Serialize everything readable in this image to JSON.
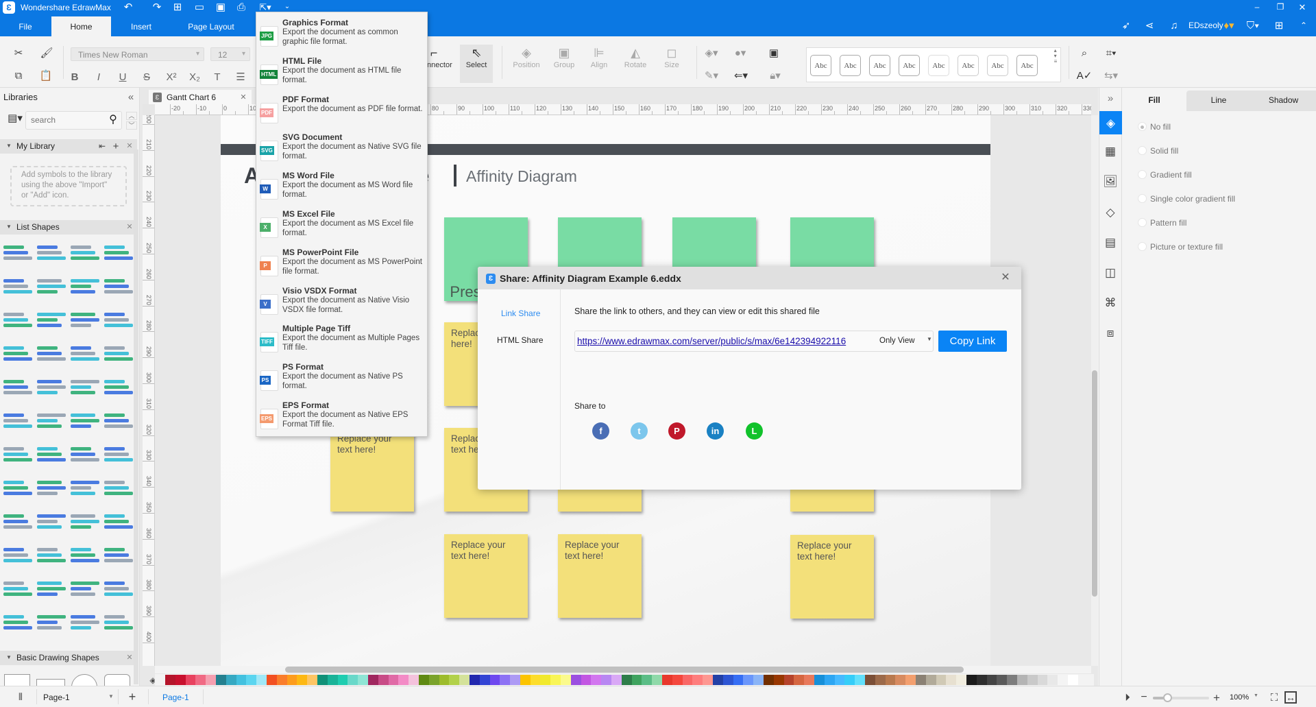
{
  "app": {
    "title": "Wondershare EdrawMax",
    "user": "EDszeoly",
    "tabs": [
      "File",
      "Home",
      "Insert",
      "Page Layout"
    ],
    "active_tab": "Home"
  },
  "toolbar": {
    "font": "Times New Roman",
    "size": "12",
    "buttons": [
      "Connector",
      "Select",
      "Position",
      "Group",
      "Align",
      "Rotate",
      "Size"
    ],
    "style_label": "Abc",
    "format_buttons": [
      "B",
      "I",
      "U",
      "S",
      "X²",
      "X₂",
      "T"
    ]
  },
  "export_menu": [
    {
      "title": "Graphics Format",
      "desc": "Export the document as common graphic file format.",
      "icon_label": "JPG",
      "color": "#1e9e45"
    },
    {
      "title": "HTML File",
      "desc": "Export the document as HTML file format.",
      "icon_label": "HTML",
      "color": "#13833a"
    },
    {
      "title": "PDF Format",
      "desc": "Export the document as PDF file format.",
      "icon_label": "PDF",
      "color": "#f6a0a0"
    },
    {
      "title": "SVG Document",
      "desc": "Export the document as Native SVG file format.",
      "icon_label": "SVG",
      "color": "#1aa3a8"
    },
    {
      "title": "MS Word File",
      "desc": "Export the document as MS Word file format.",
      "icon_label": "W",
      "color": "#1f5cb8"
    },
    {
      "title": "MS Excel File",
      "desc": "Export the document as MS Excel file format.",
      "icon_label": "X",
      "color": "#4caf6a"
    },
    {
      "title": "MS PowerPoint File",
      "desc": "Export the document as MS PowerPoint file format.",
      "icon_label": "P",
      "color": "#ef8250"
    },
    {
      "title": "Visio VSDX Format",
      "desc": "Export the document as Native Visio VSDX file format.",
      "icon_label": "V",
      "color": "#3b6fc9"
    },
    {
      "title": "Multiple Page Tiff",
      "desc": "Export the document as Multiple Pages Tiff file.",
      "icon_label": "TIFF",
      "color": "#2cbcc8"
    },
    {
      "title": "PS Format",
      "desc": "Export the document as Native PS format.",
      "icon_label": "PS",
      "color": "#1a66c4"
    },
    {
      "title": "EPS Format",
      "desc": "Export the document as Native EPS Format Tiff file.",
      "icon_label": "EPS",
      "color": "#f49a6e"
    }
  ],
  "libraries": {
    "title": "Libraries",
    "search_placeholder": "search",
    "my_library": "My Library",
    "my_library_hint": "Add symbols to the library using the above \"Import\" or \"Add\" icon.",
    "list_shapes": "List Shapes",
    "basic_shapes": "Basic Drawing Shapes"
  },
  "document": {
    "tab": "Gantt Chart 6",
    "title_left": "A",
    "title_mid": "re",
    "subtitle": "Affinity Diagram",
    "preset_text": "Preset text",
    "note_text": "Replace your text here!",
    "note_partial": "Replac here!",
    "ruler_h": {
      "start": -20,
      "end": 330,
      "step": 10
    },
    "ruler_v": {
      "start": 200,
      "end": 400,
      "step": 10
    }
  },
  "share_dialog": {
    "title": "Share: Affinity Diagram Example 6.eddx",
    "nav": [
      "Link Share",
      "HTML Share"
    ],
    "active_nav": "Link Share",
    "description": "Share the link to others, and they can view or edit this shared file",
    "url": "https://www.edrawmax.com/server/public/s/max/6e142394922116",
    "permission": "Only View",
    "copy_button": "Copy Link",
    "share_to": "Share to",
    "social": [
      {
        "name": "facebook",
        "glyph": "f",
        "color": "#4a6eb5"
      },
      {
        "name": "twitter",
        "glyph": "t",
        "color": "#7cc6ec"
      },
      {
        "name": "pinterest",
        "glyph": "P",
        "color": "#c0192b"
      },
      {
        "name": "linkedin",
        "glyph": "in",
        "color": "#1a81c3"
      },
      {
        "name": "line",
        "glyph": "L",
        "color": "#11c22b"
      }
    ]
  },
  "right_panel": {
    "tabs": [
      "Fill",
      "Line",
      "Shadow"
    ],
    "active_tab": "Fill",
    "fill_options": [
      "No fill",
      "Solid fill",
      "Gradient fill",
      "Single color gradient fill",
      "Pattern fill",
      "Picture or texture fill"
    ],
    "selected_fill": "No fill"
  },
  "status": {
    "page_select": "Page-1",
    "page_tab": "Page-1",
    "zoom": "100%",
    "zoom_level": 0.25
  },
  "palette": [
    "#b5152b",
    "#c8102e",
    "#e8425f",
    "#f06a84",
    "#f59fb0",
    "#24808f",
    "#36a9c2",
    "#43c1df",
    "#5bd5ef",
    "#a0e8f7",
    "#f25022",
    "#fa7d2b",
    "#fd9c1c",
    "#fdb813",
    "#fdc563",
    "#109178",
    "#19b398",
    "#1fcdb0",
    "#69d8c9",
    "#8fe5d5",
    "#a0275f",
    "#c84b86",
    "#e06aa6",
    "#f38bc6",
    "#f4c2dc",
    "#5f8a13",
    "#7aa32b",
    "#9dbc2c",
    "#b2d14a",
    "#d4e29a",
    "#2127ae",
    "#3344d4",
    "#6e48ef",
    "#8d72f4",
    "#ad9af4",
    "#fcc400",
    "#fddd2b",
    "#f1e92d",
    "#f9f556",
    "#fbfa8c",
    "#9b4fe0",
    "#c256e2",
    "#d276ef",
    "#b887f2",
    "#d9a8f6",
    "#2e7d4a",
    "#3fa35f",
    "#5bbd86",
    "#8fd9a9",
    "#e8382c",
    "#f4473d",
    "#f96766",
    "#fe7d7d",
    "#fe9791",
    "#2340a6",
    "#2d55d3",
    "#366ef4",
    "#6a96fb",
    "#8ab4f7",
    "#722f00",
    "#983701",
    "#b5432b",
    "#d56641",
    "#e8795b",
    "#178fd8",
    "#2ea6f2",
    "#46baff",
    "#36cdf8",
    "#62e0fb",
    "#7b4f37",
    "#9c6a4a",
    "#b8794f",
    "#d78b60",
    "#f39f6e",
    "#8b8174",
    "#b1aa99",
    "#d0c9b5",
    "#e7e0d0",
    "#f1eddf",
    "#1b1b1b",
    "#2e2e2e",
    "#444444",
    "#5a5a5a",
    "#7d7d7d",
    "#b4b4b4",
    "#c9c9c9",
    "#d9d9d9",
    "#e8e8e8",
    "#f4f4f4",
    "#ffffff"
  ],
  "colors": {
    "accent": "#0b78e3",
    "link": "#2d8cf0",
    "note_green": "#79dca4",
    "note_yellow": "#f3e07a",
    "banner": "#4a4f55"
  }
}
